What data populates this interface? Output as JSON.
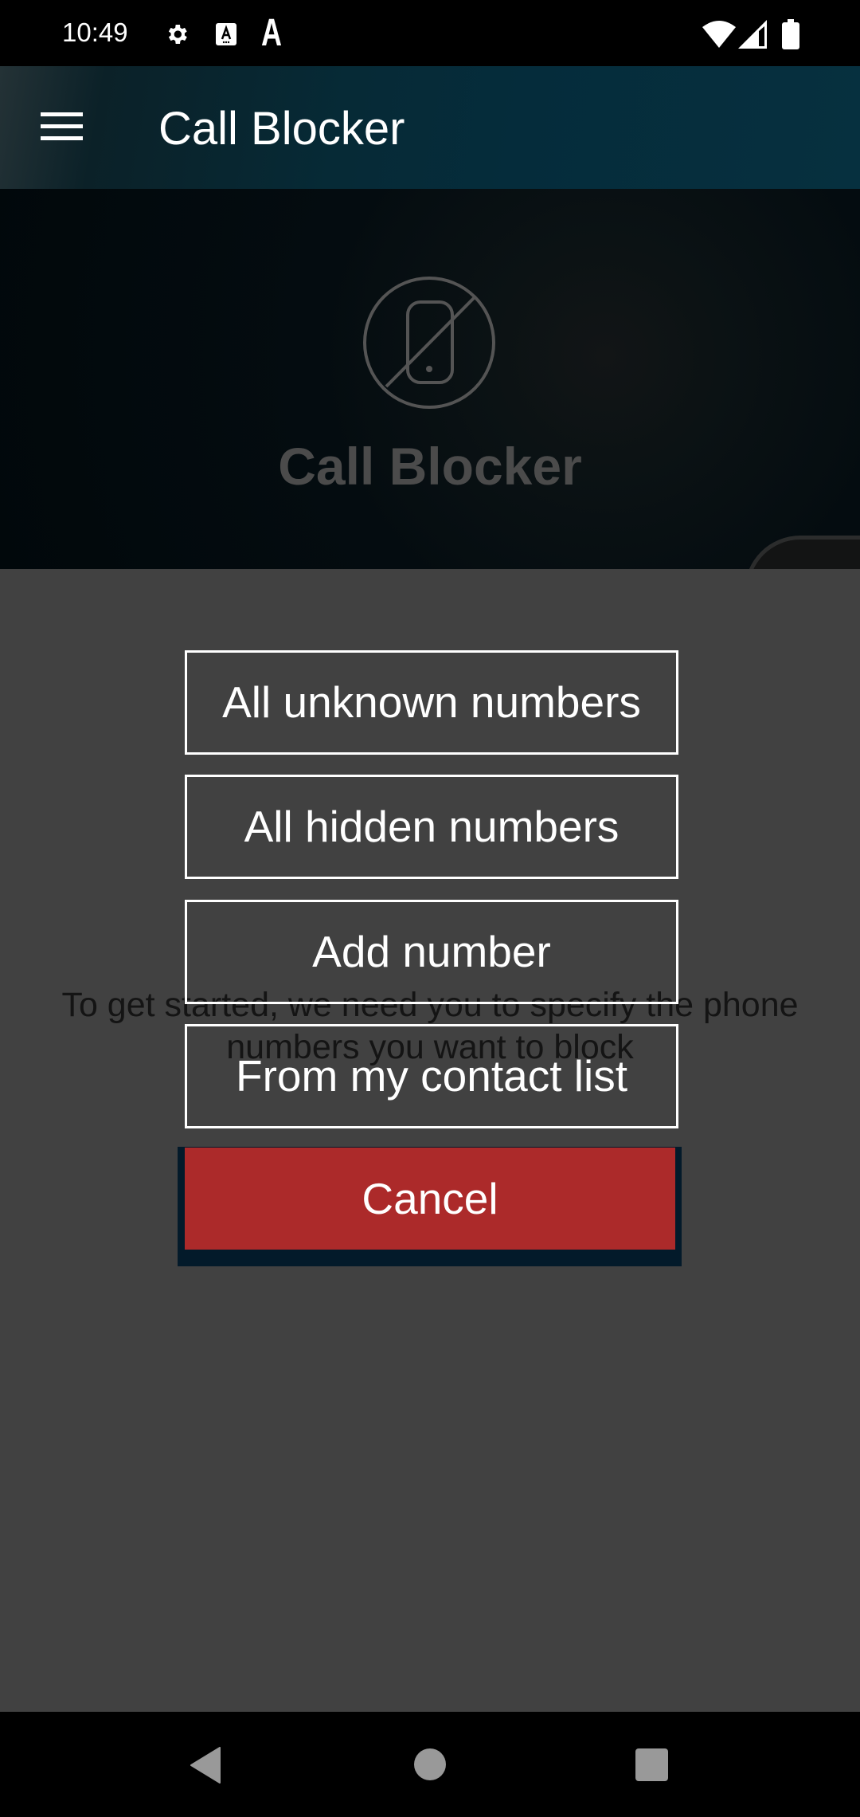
{
  "status_bar": {
    "time": "10:49",
    "icons": [
      "gear-icon",
      "accessibility-a-icon",
      "font-a-icon",
      "wifi-icon",
      "signal-icon",
      "battery-icon"
    ],
    "a_glyph": "A"
  },
  "app_bar": {
    "menu_icon": "hamburger-menu-icon",
    "title": "Call Blocker"
  },
  "hero": {
    "logo_icon": "phone-blocked-icon",
    "title": "Call Blocker"
  },
  "body": {
    "intro_text": "To get started, we need you to specify the phone numbers you want to block"
  },
  "dialog": {
    "options": [
      {
        "label": "All unknown numbers"
      },
      {
        "label": "All hidden numbers"
      },
      {
        "label": "Add number"
      },
      {
        "label": "From my contact list"
      }
    ],
    "cancel_label": "Cancel"
  },
  "colors": {
    "cancel_button": "#ac2a2a",
    "cancel_container": "#031a2a",
    "overlay": "#414141",
    "app_bar": "#052c3b"
  },
  "nav_bar": {
    "icons": [
      "back-icon",
      "home-icon",
      "recents-icon"
    ]
  }
}
